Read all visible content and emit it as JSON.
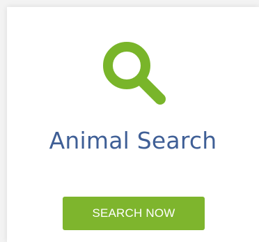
{
  "card": {
    "icon": "search-icon",
    "title": "Animal Search",
    "button_label": "SEARCH NOW"
  },
  "colors": {
    "icon_green": "#79b52a",
    "title_blue": "#3f5f96",
    "button_green": "#7eb52d",
    "button_text": "#ffffff"
  }
}
